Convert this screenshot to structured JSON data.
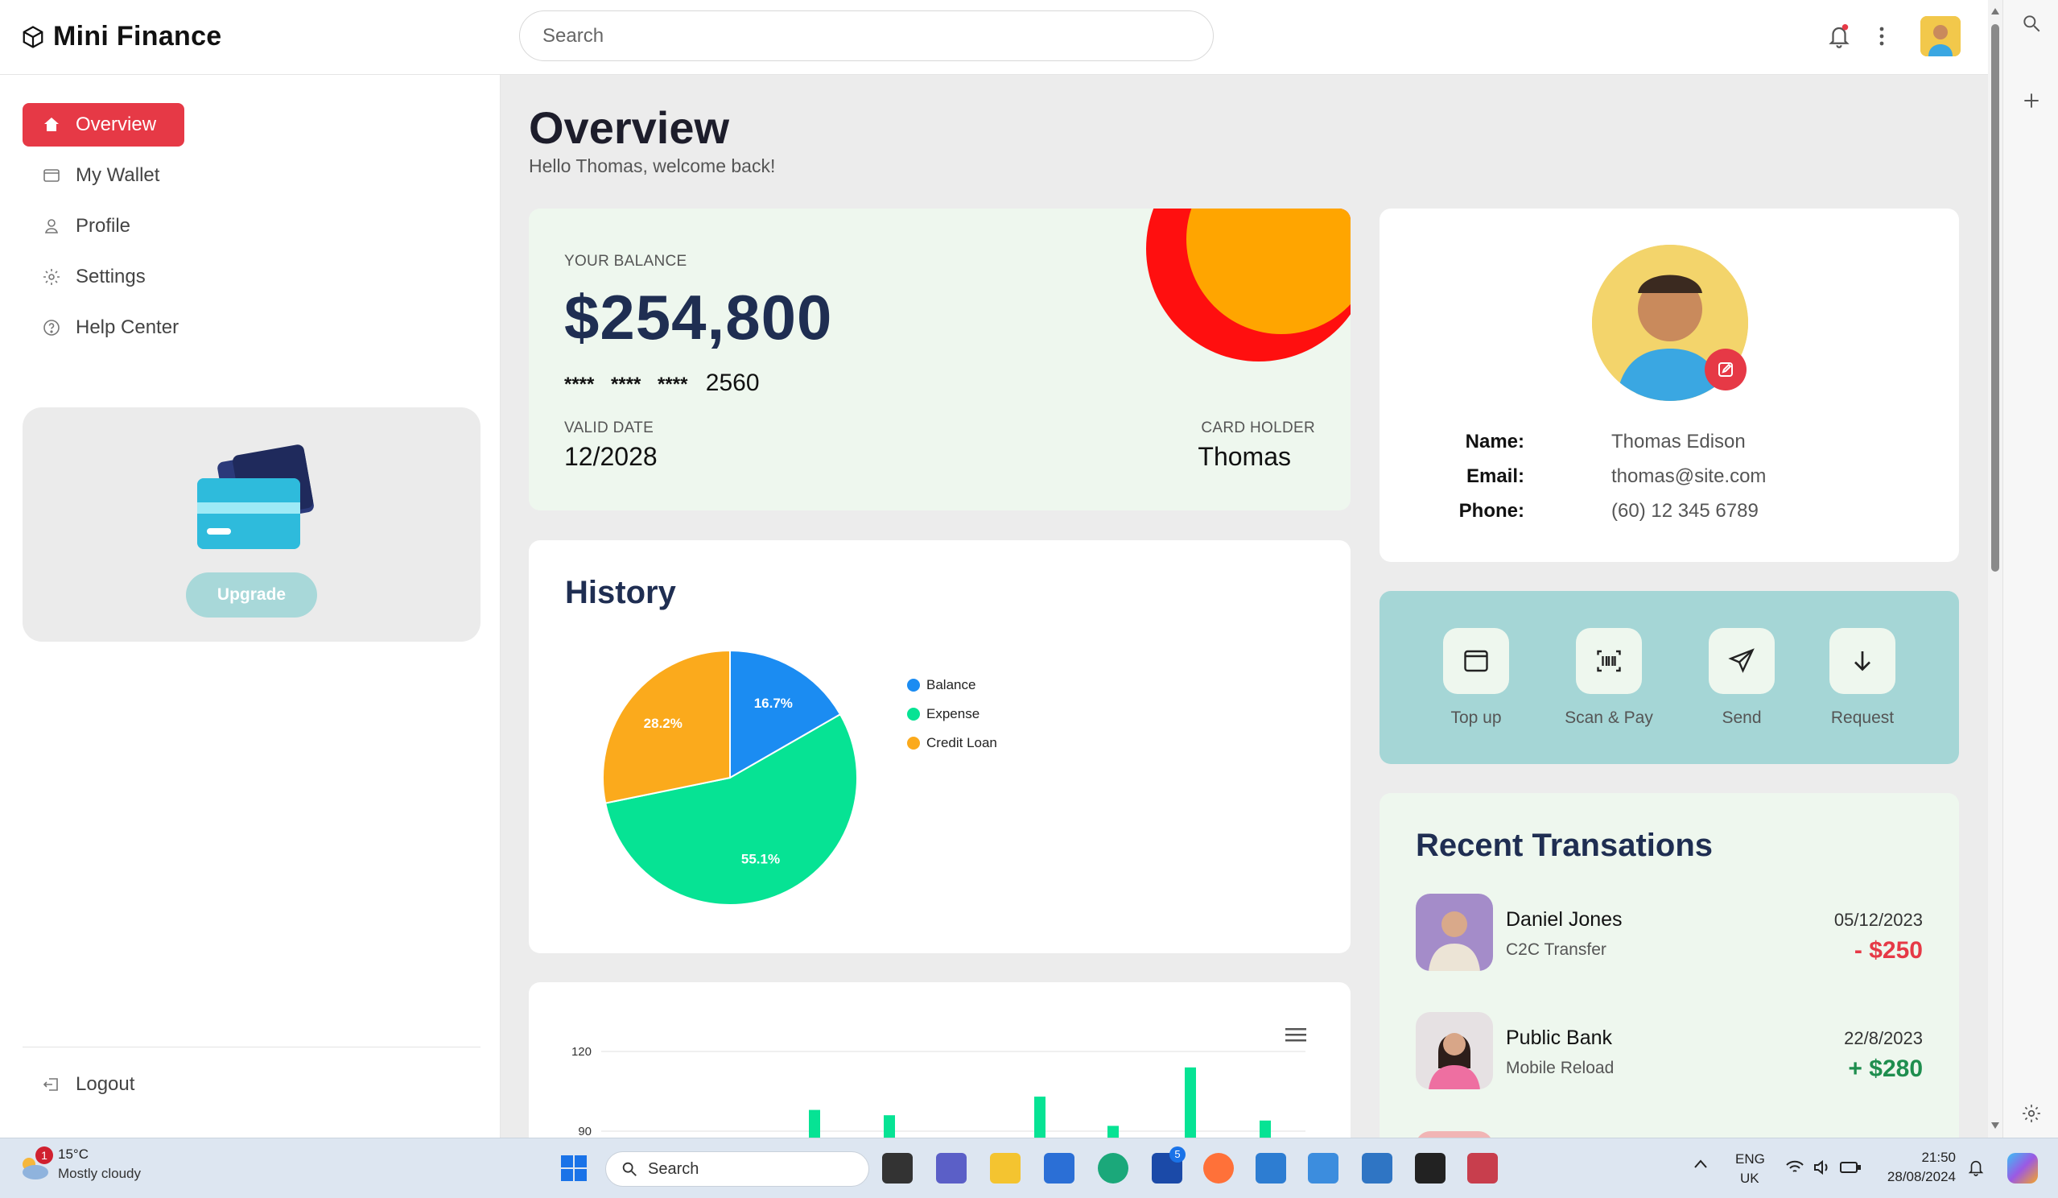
{
  "app": {
    "name": "Mini Finance"
  },
  "search": {
    "placeholder": "Search"
  },
  "sidebar": {
    "items": [
      {
        "label": "Overview",
        "icon": "home-icon",
        "active": true
      },
      {
        "label": "My Wallet",
        "icon": "wallet-icon"
      },
      {
        "label": "Profile",
        "icon": "user-icon"
      },
      {
        "label": "Settings",
        "icon": "gear-icon"
      },
      {
        "label": "Help Center",
        "icon": "help-icon"
      }
    ],
    "upgrade_label": "Upgrade",
    "logout_label": "Logout"
  },
  "page": {
    "title": "Overview",
    "welcome": "Hello Thomas, welcome back!"
  },
  "balance": {
    "label": "YOUR BALANCE",
    "amount": "$254,800",
    "card_mask": "**** **** ****",
    "card_last4": "2560",
    "valid_label": "VALID DATE",
    "valid_value": "12/2028",
    "holder_label": "CARD HOLDER",
    "holder_value": "Thomas"
  },
  "profile": {
    "name_label": "Name:",
    "name": "Thomas Edison",
    "email_label": "Email:",
    "email": "thomas@site.com",
    "phone_label": "Phone:",
    "phone": "(60) 12 345 6789"
  },
  "history": {
    "title": "History"
  },
  "chart_data": [
    {
      "type": "pie",
      "title": "History",
      "slices": [
        {
          "label": "Balance",
          "value": 16.7,
          "color": "#1b8cf2",
          "text": "16.7%"
        },
        {
          "label": "Expense",
          "value": 55.1,
          "color": "#06e394",
          "text": "55.1%"
        },
        {
          "label": "Credit Loan",
          "value": 28.2,
          "color": "#fbaa1c",
          "text": "28.2%"
        }
      ],
      "legend": "right"
    },
    {
      "type": "bar",
      "title": "",
      "yticks": [
        "120",
        "90"
      ],
      "ylim": [
        90,
        120
      ],
      "values": [
        98,
        96,
        103,
        92,
        114,
        94
      ],
      "color": "#06e394"
    }
  ],
  "actions": [
    {
      "label": "Top up",
      "icon": "card-icon"
    },
    {
      "label": "Scan & Pay",
      "icon": "barcode-icon"
    },
    {
      "label": "Send",
      "icon": "send-icon"
    },
    {
      "label": "Request",
      "icon": "arrow-down-icon"
    }
  ],
  "transactions": {
    "title": "Recent Transations",
    "items": [
      {
        "name": "Daniel Jones",
        "type": "C2C Transfer",
        "date": "05/12/2023",
        "amount": "- $250",
        "color": "#e63946"
      },
      {
        "name": "Public Bank",
        "type": "Mobile Reload",
        "date": "22/8/2023",
        "amount": "+ $280",
        "color": "#1e8e4e"
      }
    ]
  },
  "taskbar": {
    "weather_badge": "1",
    "temp": "15°C",
    "condition": "Mostly cloudy",
    "search": "Search",
    "lang_top": "ENG",
    "lang_bottom": "UK",
    "time": "21:50",
    "date": "28/08/2024",
    "lync_badge": "5"
  }
}
